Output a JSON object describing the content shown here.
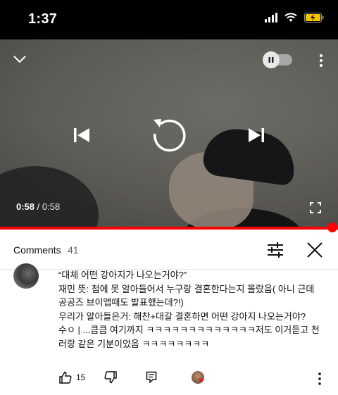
{
  "status_bar": {
    "time": "1:37"
  },
  "player": {
    "current_time": "0:58",
    "separator": " / ",
    "total_time": "0:58",
    "progress": 1.0,
    "autoplay": "paused"
  },
  "comments_header": {
    "title": "Comments",
    "count": "41"
  },
  "comment": {
    "lines": [
      "“대체 어떤 강아지가 나오는거야?”",
      "재민 뜻: 첨에 못 알아들어서 누구랑 결혼한다는지 몰랐음( 아니 근데",
      "공공즈 브이앱때도 발표했는데?!)",
      "우리가 알아들은거: 해찬+대갈 결혼하면 어떤 강아지 나오는거야?",
      "수ㅇ | ...큼큼 여기까지 ㅋㅋㅋㅋㅋㅋㅋㅋㅋㅋㅋㅋㅋ저도 이거듣고 천",
      "러랑 같은 기분이었음 ㅋㅋㅋㅋㅋㅋㅋㅋ"
    ],
    "like_count": "15"
  },
  "colors": {
    "accent": "#ff0000",
    "text_primary": "#0f0f0f",
    "text_secondary": "#606060",
    "battery": "#f5c400"
  },
  "icons": {
    "collapse": "chevron-down-icon",
    "more": "more-vert-icon",
    "prev": "skip-previous-icon",
    "replay": "replay-icon",
    "next": "skip-next-icon",
    "fullscreen": "fullscreen-icon",
    "filter": "filter-icon",
    "close": "close-icon",
    "like": "thumb-up-icon",
    "dislike": "thumb-down-icon",
    "reply": "reply-icon",
    "creator_heart": "creator-heart-icon"
  }
}
